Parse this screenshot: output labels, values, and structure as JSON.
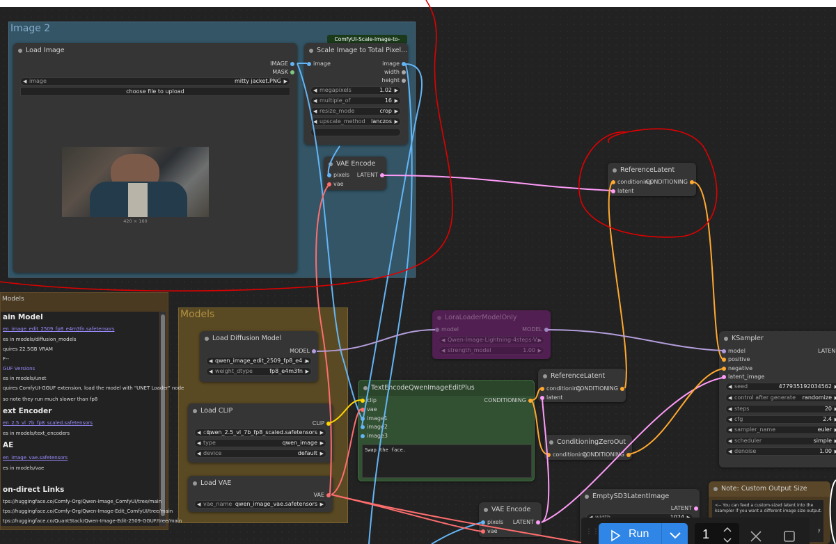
{
  "groups": {
    "image2": {
      "title": "Image 2"
    },
    "models": {
      "title": "Models"
    },
    "models_panel": {
      "title": "Models"
    }
  },
  "badge": {
    "text": "ComfyUI-Scale-Image-to-Total..."
  },
  "nodes": {
    "load_image": {
      "title": "Load Image",
      "out_image": "IMAGE",
      "out_mask": "MASK",
      "image_label": "image",
      "image_value": "mitty jacket.PNG",
      "upload_label": "choose file to upload",
      "preview_caption": "420 × 160"
    },
    "scale_image": {
      "title": "Scale Image to Total Pixel...",
      "in_image": "image",
      "out_image": "image",
      "out_width": "width",
      "out_height": "height",
      "megapixels_label": "megapixels",
      "megapixels_value": "1.02",
      "multiple_label": "multiple_of",
      "multiple_value": "16",
      "resize_label": "resize_mode",
      "resize_value": "crop",
      "upscale_label": "upscale_method",
      "upscale_value": "lanczos"
    },
    "vae_encode_top": {
      "title": "VAE Encode",
      "in_pixels": "pixels",
      "in_vae": "vae",
      "out_latent": "LATENT"
    },
    "reference_latent_top": {
      "title": "ReferenceLatent",
      "in_conditioning": "conditioning",
      "in_latent": "latent",
      "out_conditioning": "CONDITIONING"
    },
    "lora_loader": {
      "title": "LoraLoaderModelOnly",
      "in_model": "model",
      "out_model": "MODEL",
      "lora_value": "Qwen-Image-Lightning-4steps-V...",
      "strength_label": "strength_model",
      "strength_value": "1.00"
    },
    "load_diffusion": {
      "title": "Load Diffusion Model",
      "out_model": "MODEL",
      "unet_value": "qwen_image_edit_2509_fp8_e4 ...",
      "dtype_label": "weight_dtype",
      "dtype_value": "fp8_e4m3fn"
    },
    "load_clip": {
      "title": "Load CLIP",
      "out_clip": "CLIP",
      "clip_label": "cli...",
      "clip_value": "qwen_2.5_vl_7b_fp8_scaled.safetensors",
      "type_label": "type",
      "type_value": "qwen_image",
      "device_label": "device",
      "device_value": "default"
    },
    "load_vae": {
      "title": "Load VAE",
      "out_vae": "VAE",
      "vae_label": "vae_name",
      "vae_value": "qwen_image_vae.safetensors"
    },
    "text_encode": {
      "title": "TextEncodeQwenImageEditPlus",
      "in_clip": "clip",
      "in_vae": "vae",
      "in_image1": "image1",
      "in_image2": "image2",
      "in_image3": "image3",
      "out_conditioning": "CONDITIONING",
      "prompt": "Swap the face."
    },
    "reference_latent_mid": {
      "title": "ReferenceLatent",
      "in_conditioning": "conditioning",
      "in_latent": "latent",
      "out_conditioning": "CONDITIONING"
    },
    "cond_zero_out": {
      "title": "ConditioningZeroOut",
      "in_conditioning": "conditioning",
      "out_conditioning": "CONDITIONING"
    },
    "vae_encode_bottom": {
      "title": "VAE Encode",
      "in_pixels": "pixels",
      "in_vae": "vae",
      "out_latent": "LATENT"
    },
    "empty_latent": {
      "title": "EmptySD3LatentImage",
      "out_latent": "LATENT",
      "width_label": "width",
      "width_value": "1024"
    },
    "ksampler": {
      "title": "KSampler",
      "in_model": "model",
      "in_positive": "positive",
      "in_negative": "negative",
      "in_latent": "latent_image",
      "out_latent": "LATEN",
      "seed_label": "seed",
      "seed_value": "477935192034562",
      "control_label": "control after generate",
      "control_value": "randomize",
      "steps_label": "steps",
      "steps_value": "20",
      "cfg_label": "cfg",
      "cfg_value": "2.4",
      "sampler_label": "sampler_name",
      "sampler_value": "euler",
      "scheduler_label": "scheduler",
      "scheduler_value": "simple",
      "denoise_label": "denoise",
      "denoise_value": "1.00"
    },
    "note": {
      "title": "Note: Custom Output Size",
      "text1": "<-- You can feed a custom-sized latent into the",
      "text2": "ksampler if you want a different image size output.",
      "text3": "y"
    }
  },
  "models_panel": {
    "lines": [
      "ain Model",
      "en_image_edit_2509_fp8_e4m3fn.safetensors",
      "es in models/diffusion_models",
      "quires 22.5GB VRAM",
      "F--",
      "GUF Versions",
      "es in models/unet",
      "quires ComfyUI-GGUF extension, load the model with \"UNET Loader\" node",
      "so note they run much slower than fp8",
      "ext Encoder",
      "en_2.5_vl_7b_fp8_scaled.safetensors",
      "es in models/text_encoders",
      "AE",
      "en_image_vae.safetensors",
      "es in models/vae",
      "on-direct Links",
      "tps://huggingface.co/Comfy-Org/Qwen-Image_ComfyUI/tree/main",
      "tps://huggingface.co/Comfy-Org/Qwen-Image-Edit_ComfyUI/tree/main",
      "tps://huggingface.co/QuantStack/Qwen-Image-Edit-2509-GGUF/tree/main"
    ]
  },
  "runbar": {
    "run_label": "Run",
    "queue_count": "1"
  },
  "colors": {
    "wire_image": "#64b5f6",
    "wire_vae": "#ff6e6e",
    "wire_latent": "#ff9cf9",
    "wire_conditioning": "#ffa931",
    "wire_model": "#b39ddb",
    "wire_clip": "#ffd500",
    "annotation": "#e00000"
  }
}
